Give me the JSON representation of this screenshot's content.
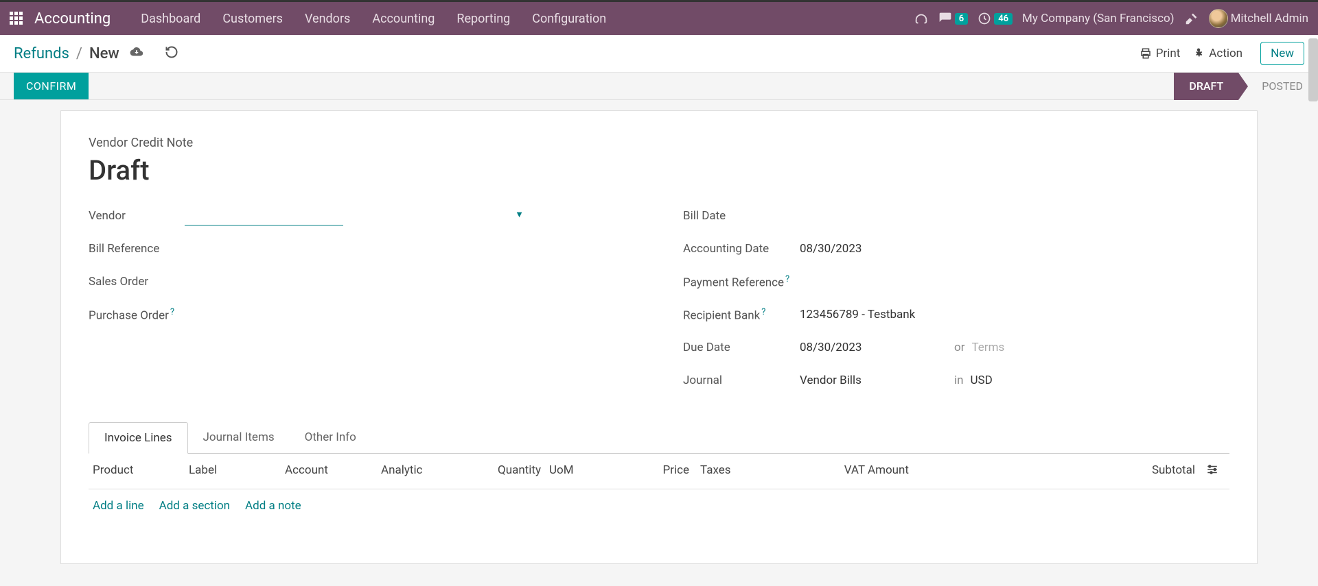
{
  "topbar": {
    "app_title": "Accounting",
    "nav": [
      "Dashboard",
      "Customers",
      "Vendors",
      "Accounting",
      "Reporting",
      "Configuration"
    ],
    "messages_badge": "6",
    "activities_badge": "46",
    "company": "My Company (San Francisco)",
    "user": "Mitchell Admin"
  },
  "header": {
    "breadcrumb_root": "Refunds",
    "breadcrumb_current": "New",
    "print": "Print",
    "action": "Action",
    "new": "New"
  },
  "actionbar": {
    "confirm": "CONFIRM",
    "status_draft": "DRAFT",
    "status_posted": "POSTED"
  },
  "doc": {
    "type": "Vendor Credit Note",
    "title": "Draft"
  },
  "left": {
    "vendor_label": "Vendor",
    "vendor_value": "",
    "billref_label": "Bill Reference",
    "so_label": "Sales Order",
    "po_label": "Purchase Order"
  },
  "right": {
    "billdate_label": "Bill Date",
    "acctdate_label": "Accounting Date",
    "acctdate_value": "08/30/2023",
    "payref_label": "Payment Reference",
    "bank_label": "Recipient Bank",
    "bank_value": "123456789 - Testbank",
    "due_label": "Due Date",
    "due_value": "08/30/2023",
    "or": "or",
    "terms_ph": "Terms",
    "journal_label": "Journal",
    "journal_value": "Vendor Bills",
    "in": "in",
    "currency": "USD"
  },
  "tabs": [
    "Invoice Lines",
    "Journal Items",
    "Other Info"
  ],
  "columns": {
    "product": "Product",
    "label": "Label",
    "account": "Account",
    "analytic": "Analytic",
    "qty": "Quantity",
    "uom": "UoM",
    "price": "Price",
    "taxes": "Taxes",
    "vat": "VAT Amount",
    "subtotal": "Subtotal"
  },
  "adds": {
    "line": "Add a line",
    "section": "Add a section",
    "note": "Add a note"
  }
}
